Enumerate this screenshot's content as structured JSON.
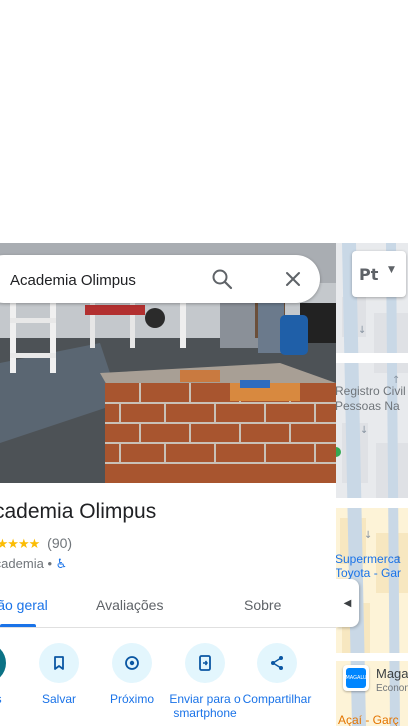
{
  "search": {
    "value": "Academia Olimpus"
  },
  "place": {
    "title": "Academia Olimpus",
    "rating_count": "(90)",
    "stars": "★★★★★",
    "category": "Academia",
    "separator": "•"
  },
  "tabs": [
    {
      "label": "Visão geral",
      "active": true
    },
    {
      "label": "Avaliações"
    },
    {
      "label": "Sobre"
    }
  ],
  "actions": [
    {
      "label": "Rotas",
      "icon": "directions-icon"
    },
    {
      "label": "Salvar",
      "icon": "bookmark-icon"
    },
    {
      "label": "Próximo",
      "icon": "nearby-icon"
    },
    {
      "label": "Enviar para o smartphone",
      "icon": "send-to-phone-icon"
    },
    {
      "label": "Compartilhar",
      "icon": "share-icon"
    }
  ],
  "map": {
    "layer_label": "Pt",
    "labels": {
      "registro_1": "Registro Civil",
      "registro_2": "Pessoas Na",
      "super_1": "Supermerca",
      "super_2": "Toyota - Gar",
      "store_1": "Magalu",
      "store_2": "Econom",
      "store_3": "Açaí - Garç"
    },
    "store_logo": "magalu"
  },
  "colors": {
    "accent": "#1a73e8",
    "star": "#fbbc04",
    "action_bg": "#e3f6fd"
  }
}
